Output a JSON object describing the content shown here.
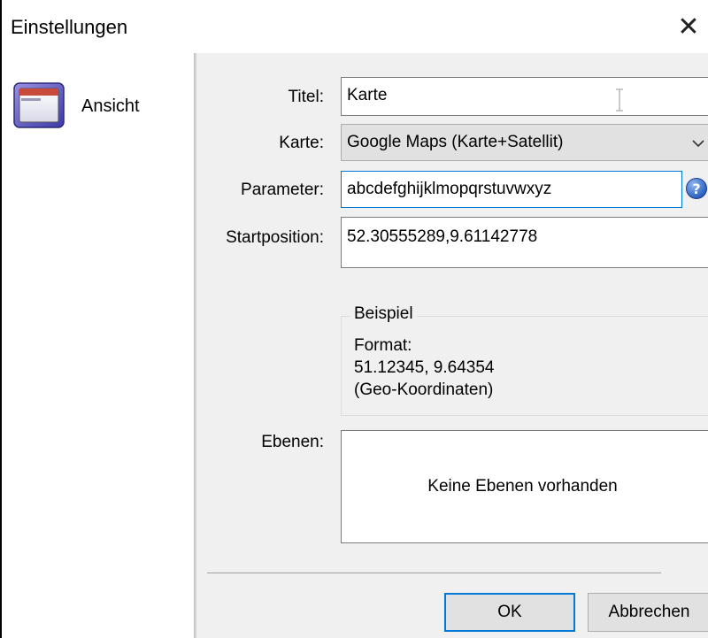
{
  "window": {
    "title": "Einstellungen",
    "close_glyph": "✕"
  },
  "sidebar": {
    "items": [
      {
        "label": "Ansicht",
        "icon": "window-icon",
        "selected": true
      }
    ]
  },
  "form": {
    "title_label": "Titel:",
    "title_value": "Karte",
    "map_label": "Karte:",
    "map_value": "Google Maps (Karte+Satellit)",
    "parameter_label": "Parameter:",
    "parameter_value": "abcdefghijklmopqrstuvwxyz",
    "start_label": "Startposition:",
    "start_value": "52.30555289,9.61142778",
    "example": {
      "legend": "Beispiel",
      "line1": "Format:",
      "line2": "51.12345, 9.64354",
      "line3": "(Geo-Koordinaten)"
    },
    "layers_label": "Ebenen:",
    "layers_empty": "Keine Ebenen vorhanden"
  },
  "buttons": {
    "ok": "OK",
    "cancel": "Abbrechen"
  },
  "colors": {
    "focus": "#0078d7",
    "help_icon": "#2f6fc5"
  }
}
